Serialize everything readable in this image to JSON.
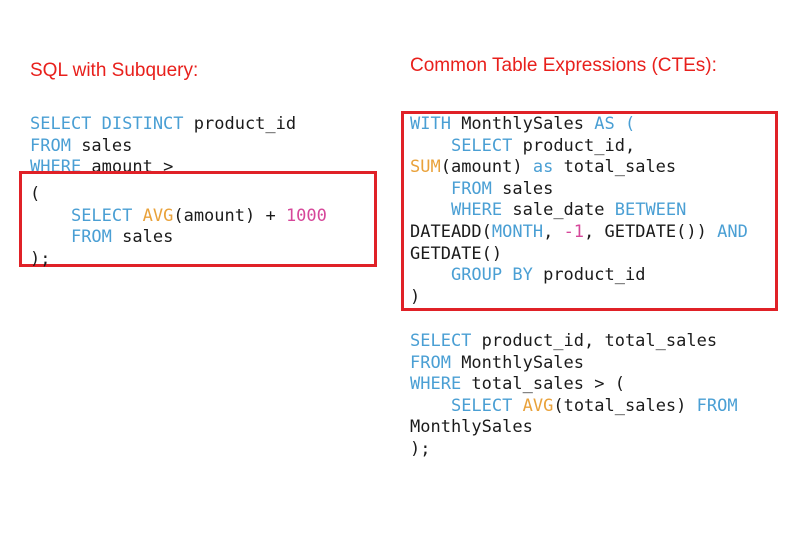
{
  "colors": {
    "heading": "#e8201c",
    "box_border": "#e02127",
    "keyword": "#4a9fd4",
    "function": "#e9a23b",
    "number": "#d6479a",
    "text": "#1b1b1b"
  },
  "left": {
    "heading": "SQL with Subquery:",
    "outer_query": [
      [
        [
          "kw",
          "SELECT DISTINCT"
        ],
        [
          "tx",
          " product_id"
        ]
      ],
      [
        [
          "kw",
          "FROM"
        ],
        [
          "tx",
          " sales"
        ]
      ],
      [
        [
          "kw",
          "WHERE"
        ],
        [
          "tx",
          " amount >"
        ]
      ]
    ],
    "subquery": [
      [
        [
          "tx",
          "("
        ]
      ],
      [
        [
          "tx",
          "    "
        ],
        [
          "kw",
          "SELECT"
        ],
        [
          "tx",
          " "
        ],
        [
          "fn",
          "AVG"
        ],
        [
          "tx",
          "(amount) + "
        ],
        [
          "num",
          "1000"
        ]
      ],
      [
        [
          "tx",
          "    "
        ],
        [
          "kw",
          "FROM"
        ],
        [
          "tx",
          " sales"
        ]
      ],
      [
        [
          "tx",
          ");"
        ]
      ]
    ]
  },
  "right": {
    "heading": "Common Table Expressions (CTEs):",
    "cte_block": [
      [
        [
          "kw",
          "WITH"
        ],
        [
          "tx",
          " MonthlySales "
        ],
        [
          "kw",
          "AS ("
        ]
      ],
      [
        [
          "tx",
          "    "
        ],
        [
          "kw",
          "SELECT"
        ],
        [
          "tx",
          " product_id,"
        ]
      ],
      [
        [
          "fn",
          "SUM"
        ],
        [
          "tx",
          "(amount) "
        ],
        [
          "kw",
          "as"
        ],
        [
          "tx",
          " total_sales"
        ]
      ],
      [
        [
          "tx",
          "    "
        ],
        [
          "kw",
          "FROM"
        ],
        [
          "tx",
          " sales"
        ]
      ],
      [
        [
          "tx",
          "    "
        ],
        [
          "kw",
          "WHERE"
        ],
        [
          "tx",
          " sale_date "
        ],
        [
          "kw",
          "BETWEEN"
        ]
      ],
      [
        [
          "tx",
          "DATEADD("
        ],
        [
          "kw",
          "MONTH"
        ],
        [
          "tx",
          ", "
        ],
        [
          "num",
          "-1"
        ],
        [
          "tx",
          ", GETDATE()) "
        ],
        [
          "kw",
          "AND"
        ]
      ],
      [
        [
          "tx",
          "GETDATE()"
        ]
      ],
      [
        [
          "tx",
          "    "
        ],
        [
          "kw",
          "GROUP BY"
        ],
        [
          "tx",
          " product_id"
        ]
      ],
      [
        [
          "tx",
          ")"
        ]
      ]
    ],
    "main_query": [
      [
        [
          "kw",
          "SELECT"
        ],
        [
          "tx",
          " product_id, total_sales"
        ]
      ],
      [
        [
          "kw",
          "FROM"
        ],
        [
          "tx",
          " MonthlySales"
        ]
      ],
      [
        [
          "kw",
          "WHERE"
        ],
        [
          "tx",
          " total_sales > ("
        ]
      ],
      [
        [
          "tx",
          "    "
        ],
        [
          "kw",
          "SELECT"
        ],
        [
          "tx",
          " "
        ],
        [
          "fn",
          "AVG"
        ],
        [
          "tx",
          "(total_sales) "
        ],
        [
          "kw",
          "FROM"
        ]
      ],
      [
        [
          "tx",
          "MonthlySales"
        ]
      ],
      [
        [
          "tx",
          ");"
        ]
      ]
    ]
  }
}
